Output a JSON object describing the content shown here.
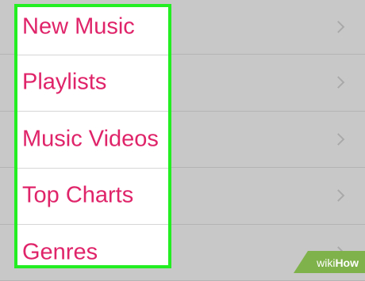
{
  "menu": {
    "items": [
      {
        "label": "New Music"
      },
      {
        "label": "Playlists"
      },
      {
        "label": "Music Videos"
      },
      {
        "label": "Top Charts"
      },
      {
        "label": "Genres"
      }
    ]
  },
  "watermark": {
    "prefix": "wiki",
    "suffix": "How"
  },
  "colors": {
    "accent_text": "#e0246a",
    "highlight_border": "#22ee22",
    "background": "#c8c8c8"
  }
}
